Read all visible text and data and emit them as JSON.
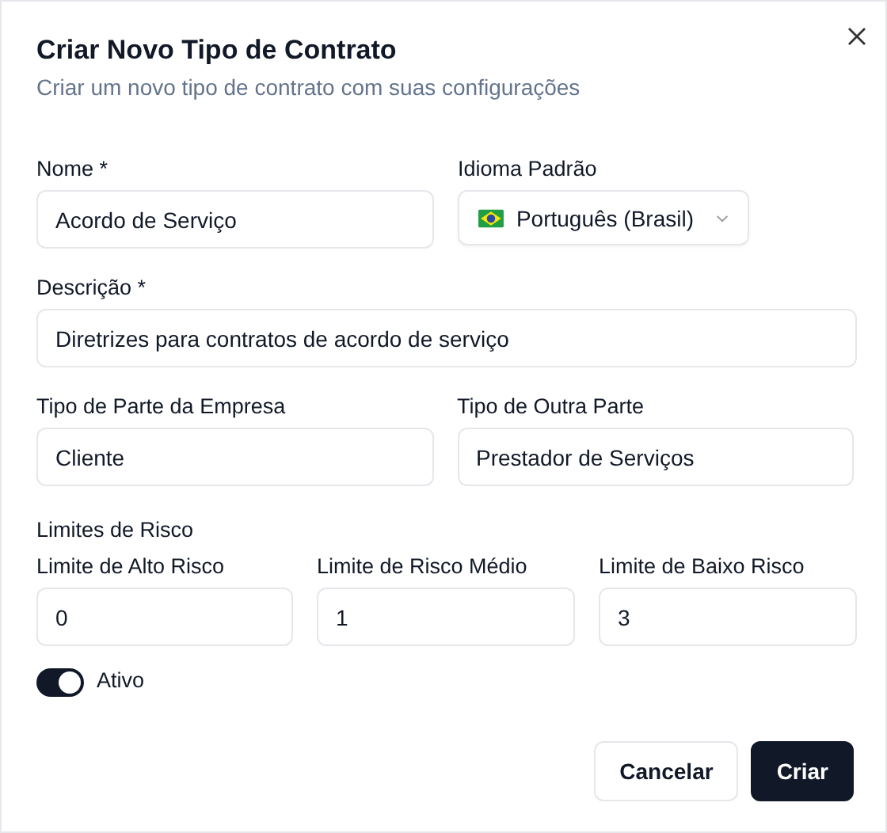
{
  "dialog": {
    "title": "Criar Novo Tipo de Contrato",
    "subtitle": "Criar um novo tipo de contrato com suas configurações"
  },
  "fields": {
    "name": {
      "label": "Nome *",
      "value": "Acordo de Serviço"
    },
    "language": {
      "label": "Idioma Padrão",
      "value": "Português (Brasil)"
    },
    "description": {
      "label": "Descrição *",
      "value": "Diretrizes para contratos de acordo de serviço"
    },
    "company_party": {
      "label": "Tipo de Parte da Empresa",
      "value": "Cliente"
    },
    "other_party": {
      "label": "Tipo de Outra Parte",
      "value": "Prestador de Serviços"
    }
  },
  "risk_limits": {
    "title": "Limites de Risco",
    "items": [
      {
        "label": "Limite de Alto Risco",
        "value": "0"
      },
      {
        "label": "Limite de Risco Médio",
        "value": "1"
      },
      {
        "label": "Limite de Baixo Risco",
        "value": "3"
      }
    ]
  },
  "active": {
    "label": "Ativo",
    "on": true
  },
  "buttons": [
    {
      "label": "Cancelar",
      "kind": "secondary"
    },
    {
      "label": "Criar",
      "kind": "primary"
    }
  ]
}
